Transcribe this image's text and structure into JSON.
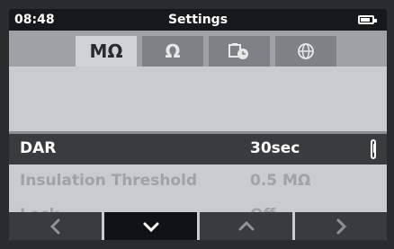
{
  "statusbar": {
    "time": "08:48",
    "title": "Settings",
    "battery_icon": "battery-icon"
  },
  "tabs": [
    {
      "label": "MΩ",
      "selected": true
    },
    {
      "label": "Ω",
      "selected": false
    },
    {
      "icon": "timer-battery-icon",
      "selected": false
    },
    {
      "icon": "globe-icon",
      "selected": false
    }
  ],
  "settings": [
    {
      "label": "DAR",
      "value": "30sec",
      "selected": true
    },
    {
      "label": "Insulation Threshold",
      "value": "0.5 MΩ",
      "selected": false
    },
    {
      "label": "Lock",
      "value": "Off",
      "selected": false
    }
  ],
  "softkeys": [
    {
      "icon": "chevron-left-icon"
    },
    {
      "icon": "chevron-down-icon",
      "active": true
    },
    {
      "icon": "chevron-up-icon"
    },
    {
      "icon": "chevron-right-icon"
    }
  ],
  "colors": {
    "accent_bg": "#3a3b3d",
    "screen_bg": "#c9cbce",
    "statusbar_bg": "#17181a"
  }
}
